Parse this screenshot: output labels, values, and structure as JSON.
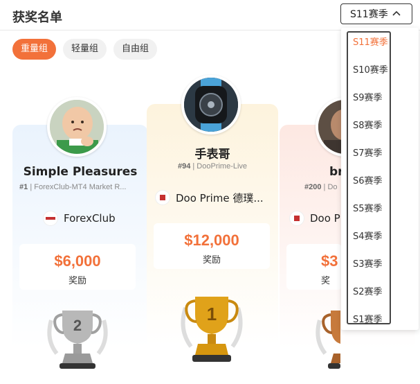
{
  "header": {
    "title": "获奖名单",
    "season_select": {
      "value": "S11赛季"
    }
  },
  "tabs": [
    {
      "label": "重量组",
      "active": true
    },
    {
      "label": "轻量组",
      "active": false
    },
    {
      "label": "自由组",
      "active": false
    }
  ],
  "winners": [
    {
      "rank": 1,
      "name": "手表哥",
      "number": "#94",
      "account": "DooPrime-Live",
      "broker": "Doo Prime 德璞...",
      "prize": "$12,000",
      "prize_label": "奖励"
    },
    {
      "rank": 2,
      "name": "Simple Pleasures",
      "number": "#1",
      "account": "ForexClub-MT4 Market R...",
      "broker": "ForexClub",
      "prize": "$6,000",
      "prize_label": "奖励"
    },
    {
      "rank": 3,
      "name": "br",
      "number": "#200",
      "account": "Do",
      "broker": "Doo P",
      "prize": "$3",
      "prize_label": "奖"
    }
  ],
  "dropdown": {
    "options": [
      "S11赛季",
      "S10赛季",
      "S9赛季",
      "S8赛季",
      "S7赛季",
      "S6赛季",
      "S5赛季",
      "S4赛季",
      "S3赛季",
      "S2赛季",
      "S1赛季"
    ],
    "selected": "S11赛季"
  },
  "colors": {
    "accent": "#f2713a",
    "gold": "#e0a21a",
    "silver": "#a9a9a9",
    "bronze": "#c77a3c"
  }
}
